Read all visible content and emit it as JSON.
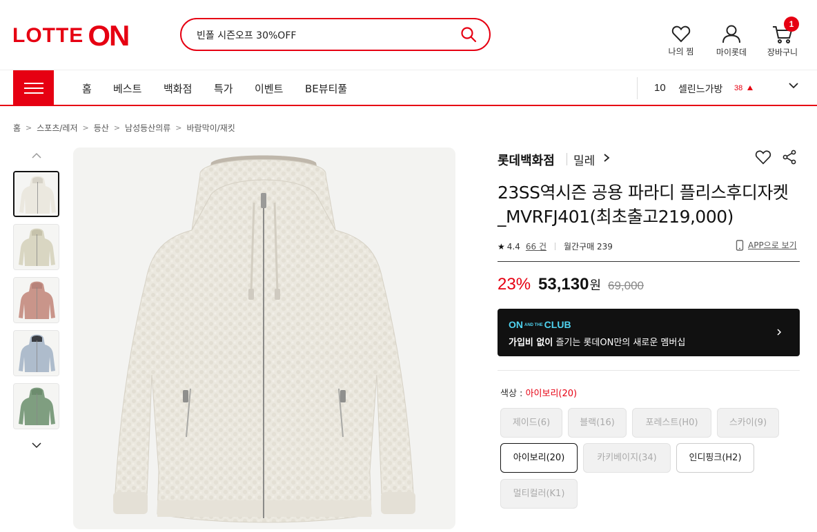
{
  "header": {
    "logo_lotte": "LOTTE",
    "logo_on": "ON",
    "search_value": "빈폴 시즌오프 30%OFF",
    "icons": [
      {
        "name": "heart-icon",
        "label": "나의 찜"
      },
      {
        "name": "user-icon",
        "label": "마이롯데"
      },
      {
        "name": "cart-icon",
        "label": "장바구니"
      }
    ],
    "cart_badge": "1"
  },
  "nav": {
    "items": [
      "홈",
      "베스트",
      "백화점",
      "특가",
      "이벤트",
      "BE뷰티풀"
    ],
    "ranking": {
      "rank": "10",
      "keyword": "셀린느가방",
      "count": "38",
      "trend": "up"
    }
  },
  "breadcrumb": [
    "홈",
    "스포츠/레저",
    "등산",
    "남성등산의류",
    "바람막이/재킷"
  ],
  "thumbnails": [
    {
      "color": "#ebe8df",
      "accent": "#d7d3c8"
    },
    {
      "color": "#d9d6c2",
      "accent": "#c6c2ab"
    },
    {
      "color": "#c9958a",
      "accent": "#b7837a"
    },
    {
      "color": "#aebccc",
      "accent": "#3a3d42"
    },
    {
      "color": "#7f9e80",
      "accent": "#6d8c6e"
    }
  ],
  "product": {
    "store": "롯데백화점",
    "brand": "밀레",
    "title": "23SS역시즌 공용 파라디 플리스후디자켓_MVRFJ401(최초출고219,000)",
    "rating": "4.4",
    "reviews": "66 건",
    "monthly": "월간구매 239",
    "app_link": "APP으로 보기",
    "discount": "23%",
    "price": "53,130",
    "won": "원",
    "original_price": "69,000"
  },
  "club": {
    "on": "ON",
    "and_the": "AND THE",
    "club": "CLUB",
    "desc_bold": "가입비 없이",
    "desc_rest": " 즐기는 롯데ON만의 새로운 멤버십"
  },
  "options": {
    "label": "색상 : ",
    "selected": "아이보리(20)",
    "colors": [
      {
        "label": "제이드(6)",
        "state": "disabled"
      },
      {
        "label": "블랙(16)",
        "state": "disabled"
      },
      {
        "label": "포레스트(H0)",
        "state": "disabled"
      },
      {
        "label": "스카이(9)",
        "state": "disabled"
      },
      {
        "label": "아이보리(20)",
        "state": "selected"
      },
      {
        "label": "카키베이지(34)",
        "state": "disabled"
      },
      {
        "label": "인디핑크(H2)",
        "state": "available"
      },
      {
        "label": "멀티컬러(K1)",
        "state": "disabled"
      }
    ]
  },
  "colors": {
    "accent": "#e60012",
    "club_bg": "#111111",
    "club_text": "#4fd3f0"
  }
}
